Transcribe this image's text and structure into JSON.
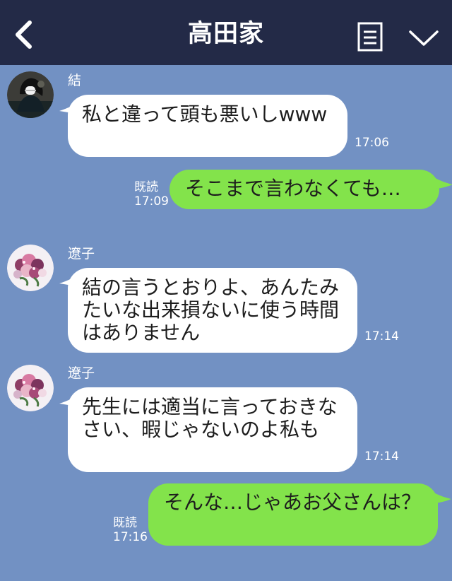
{
  "header": {
    "title": "高田家",
    "back_icon": "chevron-left-icon",
    "menu_icon": "document-menu-icon",
    "dropdown_icon": "chevron-down-icon"
  },
  "messages": [
    {
      "direction": "incoming",
      "sender": "結",
      "avatar_icon": "user-avatar-icon",
      "text": "私と違って頭も悪いしwww",
      "time": "17:06"
    },
    {
      "direction": "outgoing",
      "read_label": "既読",
      "text": "そこまで言わなくても…",
      "time": "17:09"
    },
    {
      "direction": "incoming",
      "sender": "遼子",
      "avatar_icon": "flower-bouquet-avatar-icon",
      "text": "結の言うとおりよ、あんたみたいな出来損ないに使う時間はありません",
      "time": "17:14"
    },
    {
      "direction": "incoming",
      "sender": "遼子",
      "avatar_icon": "flower-bouquet-avatar-icon",
      "text": "先生には適当に言っておきなさい、暇じゃないのよ私も",
      "time": "17:14"
    },
    {
      "direction": "outgoing",
      "read_label": "既読",
      "text": "そんな…じゃあお父さんは？",
      "time": "17:16"
    }
  ],
  "colors": {
    "header_background": "#232a47",
    "chat_background": "#7291c3",
    "incoming_bubble": "#ffffff",
    "outgoing_bubble": "#83e34b",
    "text": "#1d1d1d",
    "meta_text": "#ffffff"
  }
}
